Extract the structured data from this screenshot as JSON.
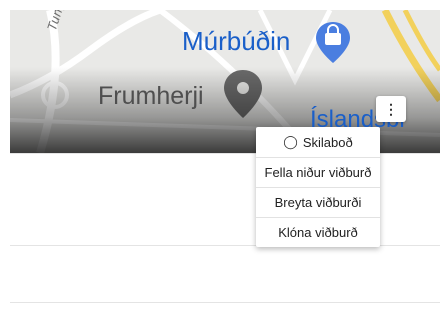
{
  "map": {
    "labels": {
      "tungu": "Tungu",
      "murbudin": "Múrbúðin",
      "frumherji": "Frumherji",
      "island": "Íslandsbi"
    },
    "icons": {
      "shop_pin": "shopping-bag-pin-icon",
      "place_pin": "map-pin-icon"
    },
    "colors": {
      "blue_label": "#1a5fc9",
      "road_yellow": "#f2d15c"
    }
  },
  "overflow_button": {
    "icon": "more-vertical-icon",
    "glyph": "⋮"
  },
  "menu": {
    "items": [
      {
        "label": "Skilaboð",
        "icon": "message-icon",
        "glyph": "◯"
      },
      {
        "label": "Fella niður viðburð"
      },
      {
        "label": "Breyta viðburði"
      },
      {
        "label": "Klóna viðburð"
      }
    ]
  }
}
